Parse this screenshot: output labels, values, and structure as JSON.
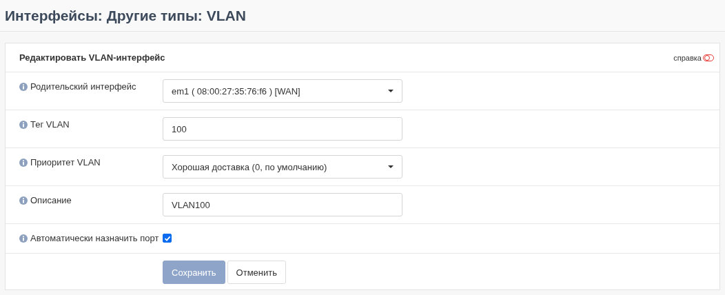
{
  "page_title": "Интерфейсы: Другие типы: VLAN",
  "form": {
    "title": "Редактировать VLAN-интерфейс",
    "help": {
      "label": "справка",
      "on": false
    },
    "fields": [
      {
        "kind": "select",
        "label": "Родительский интерфейс",
        "value": "em1 ( 08:00:27:35:76:f6 ) [WAN]"
      },
      {
        "kind": "text",
        "label": "Тег VLAN",
        "value": "100"
      },
      {
        "kind": "select",
        "label": "Приоритет VLAN",
        "value": "Хорошая доставка (0, по умолчанию)"
      },
      {
        "kind": "text",
        "label": "Описание",
        "value": "VLAN100"
      },
      {
        "kind": "checkbox",
        "label": "Автоматически назначить порт",
        "checked": true
      }
    ],
    "buttons": [
      {
        "kind": "primary",
        "label": "Сохранить"
      },
      {
        "kind": "default",
        "label": "Отменить"
      }
    ]
  }
}
